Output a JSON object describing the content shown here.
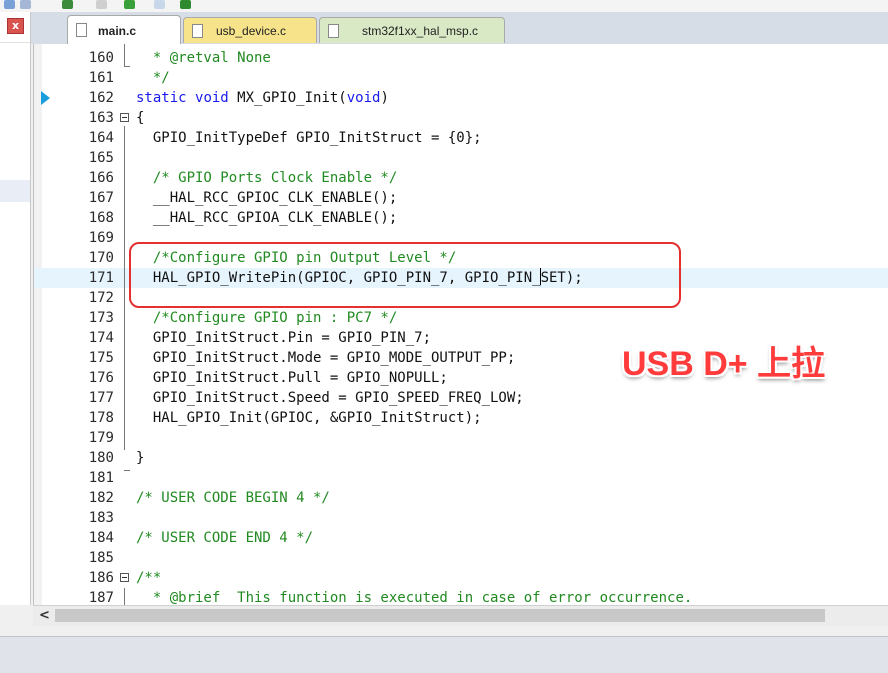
{
  "tabs": [
    {
      "label": "main.c",
      "active": true
    },
    {
      "label": "usb_device.c",
      "active": false
    },
    {
      "label": "stm32f1xx_hal_msp.c",
      "active": false
    }
  ],
  "left_panel": {
    "close_glyph": "x"
  },
  "annotation": {
    "text": "USB D+ 上拉"
  },
  "lines": [
    {
      "n": "160",
      "code": "  * @retval None"
    },
    {
      "n": "161",
      "code": "  */"
    },
    {
      "n": "162",
      "code": "static void MX_GPIO_Init(void)"
    },
    {
      "n": "163",
      "code": "{"
    },
    {
      "n": "164",
      "code": "  GPIO_InitTypeDef GPIO_InitStruct = {0};"
    },
    {
      "n": "165",
      "code": ""
    },
    {
      "n": "166",
      "code": "  /* GPIO Ports Clock Enable */"
    },
    {
      "n": "167",
      "code": "  __HAL_RCC_GPIOC_CLK_ENABLE();"
    },
    {
      "n": "168",
      "code": "  __HAL_RCC_GPIOA_CLK_ENABLE();"
    },
    {
      "n": "169",
      "code": ""
    },
    {
      "n": "170",
      "code": "  /*Configure GPIO pin Output Level */"
    },
    {
      "n": "171",
      "code": "  HAL_GPIO_WritePin(GPIOC, GPIO_PIN_7, GPIO_PIN_SET);"
    },
    {
      "n": "172",
      "code": ""
    },
    {
      "n": "173",
      "code": "  /*Configure GPIO pin : PC7 */"
    },
    {
      "n": "174",
      "code": "  GPIO_InitStruct.Pin = GPIO_PIN_7;"
    },
    {
      "n": "175",
      "code": "  GPIO_InitStruct.Mode = GPIO_MODE_OUTPUT_PP;"
    },
    {
      "n": "176",
      "code": "  GPIO_InitStruct.Pull = GPIO_NOPULL;"
    },
    {
      "n": "177",
      "code": "  GPIO_InitStruct.Speed = GPIO_SPEED_FREQ_LOW;"
    },
    {
      "n": "178",
      "code": "  HAL_GPIO_Init(GPIOC, &GPIO_InitStruct);"
    },
    {
      "n": "179",
      "code": ""
    },
    {
      "n": "180",
      "code": "}"
    },
    {
      "n": "181",
      "code": ""
    },
    {
      "n": "182",
      "code": "/* USER CODE BEGIN 4 */"
    },
    {
      "n": "183",
      "code": ""
    },
    {
      "n": "184",
      "code": "/* USER CODE END 4 */"
    },
    {
      "n": "185",
      "code": ""
    },
    {
      "n": "186",
      "code": "/**"
    },
    {
      "n": "187",
      "code": "  * @brief  This function is executed in case of error occurrence."
    }
  ],
  "colors": {
    "keyword": "#1a1aee",
    "comment": "#218a21",
    "highlight_box": "#e53030",
    "annotation": "#ff3b3b",
    "current_line": "#e6f4fe"
  }
}
